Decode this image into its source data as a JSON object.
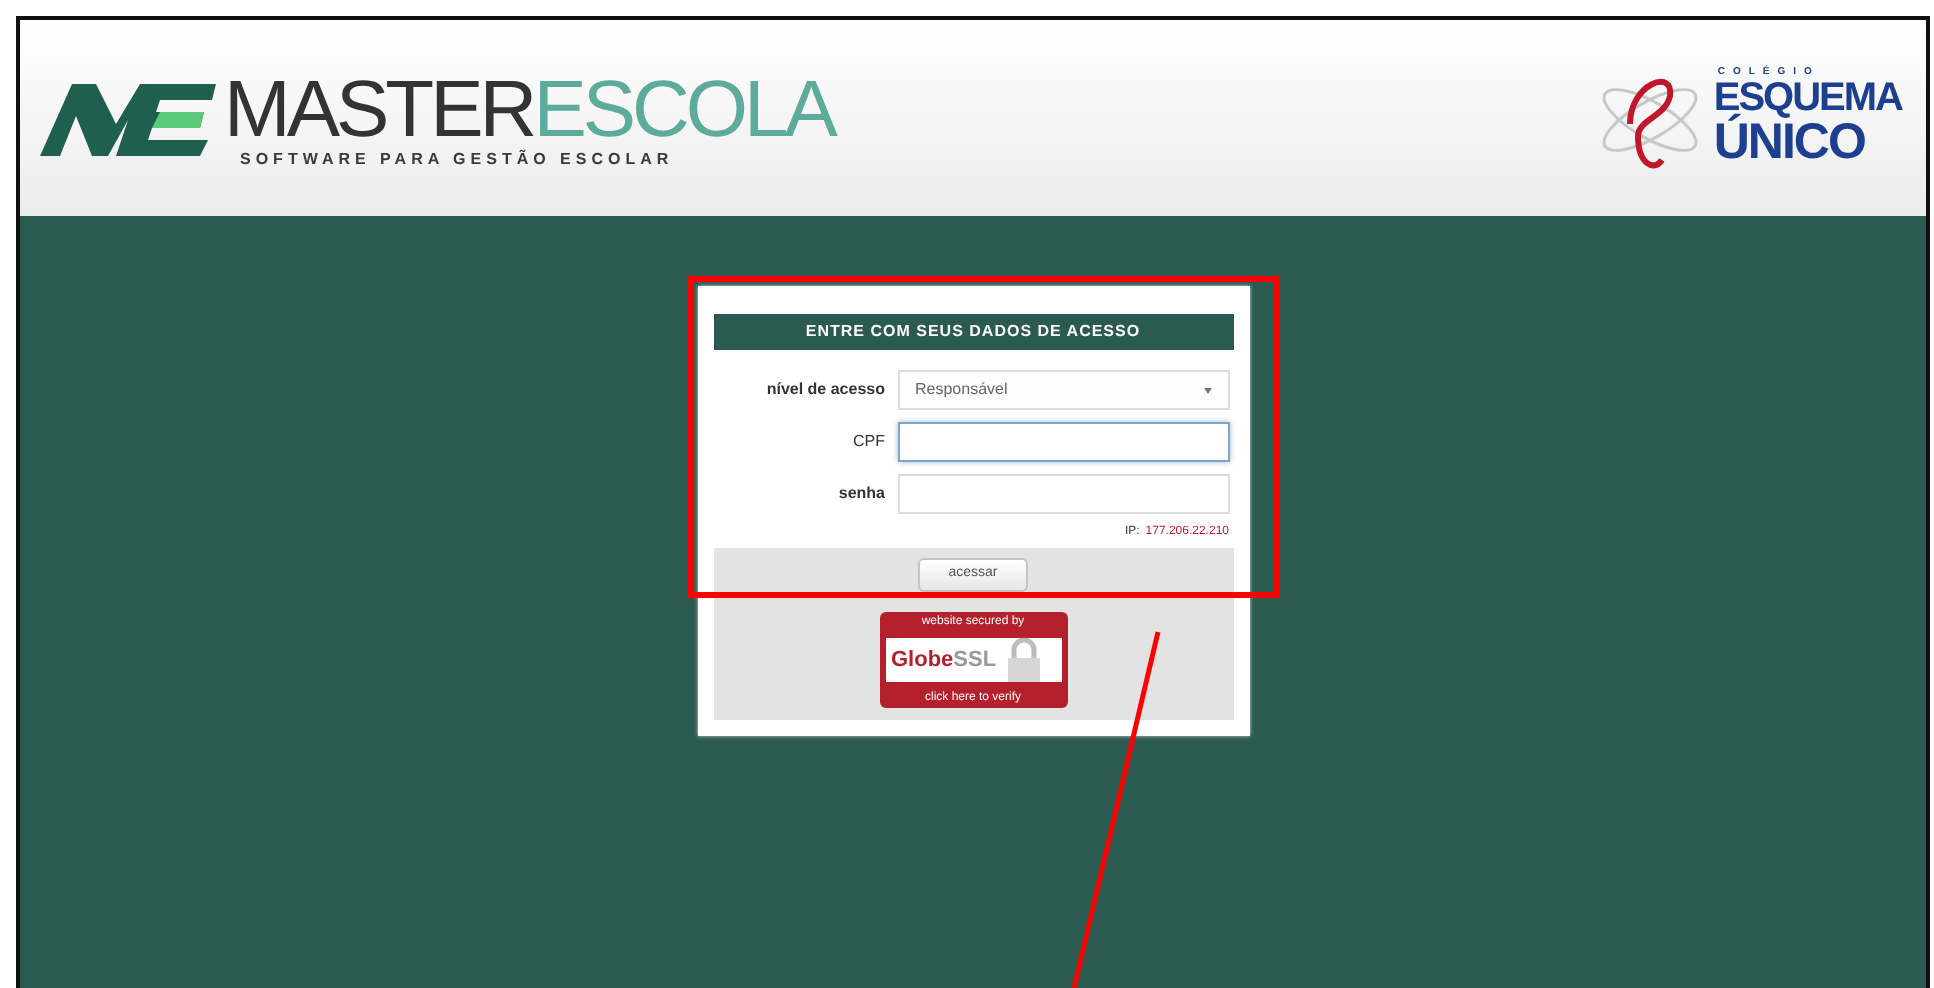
{
  "header": {
    "brand": {
      "part_1": "MASTER",
      "part_2": "ESCOLA",
      "tagline": "SOFTWARE PARA GESTÃO ESCOLAR"
    },
    "school": {
      "overline": "COLÉGIO",
      "line_1": "ESQUEMA",
      "line_2": "ÚNICO"
    }
  },
  "login": {
    "title": "ENTRE COM SEUS DADOS DE ACESSO",
    "fields": [
      {
        "kind": "select",
        "label": "nível de acesso",
        "value": "Responsável",
        "focused": false
      },
      {
        "kind": "text",
        "label": "CPF",
        "focused": true
      },
      {
        "kind": "password",
        "label": "senha",
        "focused": false
      }
    ],
    "ip_label": "IP:",
    "ip": "177.206.22.210",
    "submit": "acessar"
  },
  "ssl_badge": {
    "top": "website secured by",
    "brand_1": "Globe",
    "brand_2": "SSL",
    "bottom": "click here to verify"
  }
}
